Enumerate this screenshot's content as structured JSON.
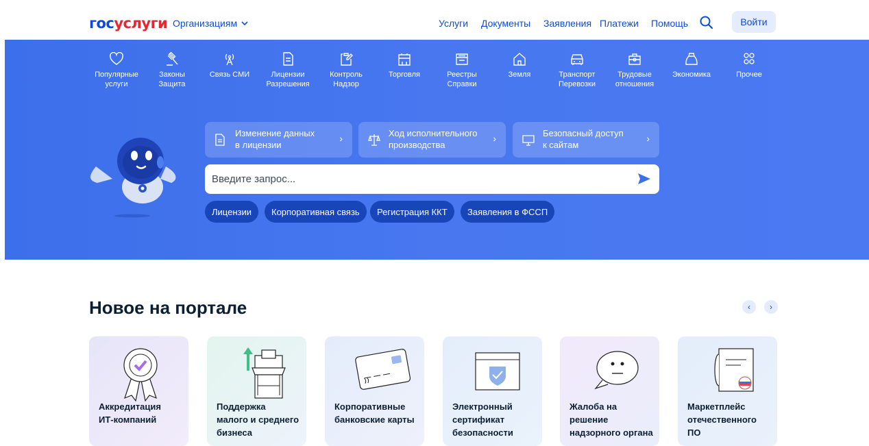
{
  "header": {
    "logo_part1": "гос",
    "logo_part2": "услуги",
    "org_menu": "Организациям",
    "nav": [
      "Услуги",
      "Документы",
      "Заявления",
      "Платежи",
      "Помощь"
    ],
    "login": "Войти"
  },
  "categories": [
    {
      "l1": "Популярные",
      "l2": "услуги",
      "icon": "heart-icon"
    },
    {
      "l1": "Законы",
      "l2": "Защита",
      "icon": "gavel-icon"
    },
    {
      "l1": "Связь СМИ",
      "l2": "",
      "icon": "antenna-icon"
    },
    {
      "l1": "Лицензии",
      "l2": "Разрешения",
      "icon": "document-icon"
    },
    {
      "l1": "Контроль",
      "l2": "Надзор",
      "icon": "clipboard-edit-icon"
    },
    {
      "l1": "Торговля",
      "l2": "",
      "icon": "stall-icon"
    },
    {
      "l1": "Реестры",
      "l2": "Справки",
      "icon": "folder-icon"
    },
    {
      "l1": "Земля",
      "l2": "",
      "icon": "house-icon"
    },
    {
      "l1": "Транспорт",
      "l2": "Перевозки",
      "icon": "car-icon"
    },
    {
      "l1": "Трудовые",
      "l2": "отношения",
      "icon": "briefcase-icon"
    },
    {
      "l1": "Экономика",
      "l2": "",
      "icon": "moneybag-icon"
    },
    {
      "l1": "Прочее",
      "l2": "",
      "icon": "grid-icon"
    }
  ],
  "quick_links": [
    {
      "l1": "Изменение данных",
      "l2": "в лицензии"
    },
    {
      "l1": "Ход исполнительного",
      "l2": "производства"
    },
    {
      "l1": "Безопасный доступ",
      "l2": "к сайтам"
    }
  ],
  "search": {
    "placeholder": "Введите запрос..."
  },
  "chips": [
    "Лицензии",
    "Корпоративная связь",
    "Регистрация ККТ",
    "Заявления в ФССП"
  ],
  "news": {
    "title": "Новое на портале",
    "cards": [
      {
        "lines": [
          "Аккредитация",
          "ИТ-компаний"
        ],
        "bg": "#eeeafa"
      },
      {
        "lines": [
          "Поддержка",
          "малого и среднего",
          "бизнеса"
        ],
        "bg": "#eaf5f3"
      },
      {
        "lines": [
          "Корпоративные",
          "банковские карты"
        ],
        "bg": "#e9f0fb"
      },
      {
        "lines": [
          "Электронный",
          "сертификат",
          "безопасности"
        ],
        "bg": "#e8f0fb"
      },
      {
        "lines": [
          "Жалоба на",
          "решение",
          "надзорного органа"
        ],
        "bg": "#f3ecfa"
      },
      {
        "lines": [
          "Маркетплейс",
          "отечественного",
          "ПО"
        ],
        "bg": "#e8f1fb"
      }
    ]
  },
  "colors": {
    "brand_blue": "#0d4cd3",
    "brand_red": "#e5282f",
    "hero_bg": "#4877f0",
    "chip_bg": "#1846b9"
  }
}
